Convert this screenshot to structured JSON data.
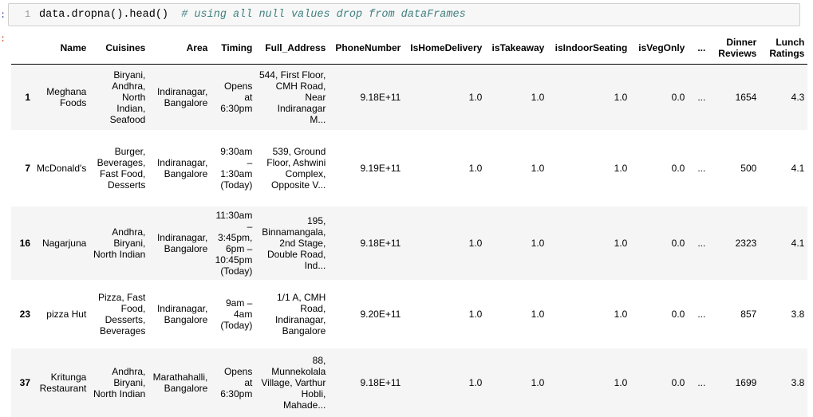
{
  "prompt": {
    "in_marker": ":",
    "out_marker": ":"
  },
  "code_cell": {
    "line_number": "1",
    "code": "data.dropna().head()",
    "comment": "# using all null values drop from dataFrames"
  },
  "table": {
    "columns": [
      "",
      "Name",
      "Cuisines",
      "Area",
      "Timing",
      "Full_Address",
      "PhoneNumber",
      "IsHomeDelivery",
      "isTakeaway",
      "isIndoorSeating",
      "isVegOnly",
      "...",
      "Dinner Reviews",
      "Lunch Ratings"
    ],
    "rows": [
      [
        "1",
        "Meghana Foods",
        "Biryani, Andhra, North Indian, Seafood",
        "Indiranagar, Bangalore",
        "Opens at 6:30pm",
        "544, First Floor, CMH Road, Near Indiranagar M...",
        "9.18E+11",
        "1.0",
        "1.0",
        "1.0",
        "0.0",
        "...",
        "1654",
        "4.3"
      ],
      [
        "7",
        "McDonald's",
        "Burger, Beverages, Fast Food, Desserts",
        "Indiranagar, Bangalore",
        "9:30am – 1:30am (Today)",
        "539, Ground Floor, Ashwini Complex, Opposite V...",
        "9.19E+11",
        "1.0",
        "1.0",
        "1.0",
        "0.0",
        "...",
        "500",
        "4.1"
      ],
      [
        "16",
        "Nagarjuna",
        "Andhra, Biryani, North Indian",
        "Indiranagar, Bangalore",
        "11:30am – 3:45pm, 6pm – 10:45pm (Today)",
        "195, Binnamangala, 2nd Stage, Double Road, Ind...",
        "9.18E+11",
        "1.0",
        "1.0",
        "1.0",
        "0.0",
        "...",
        "2323",
        "4.1"
      ],
      [
        "23",
        "pizza Hut",
        "Pizza, Fast Food, Desserts, Beverages",
        "Indiranagar, Bangalore",
        "9am – 4am (Today)",
        "1/1 A, CMH Road, Indiranagar, Bangalore",
        "9.20E+11",
        "1.0",
        "1.0",
        "1.0",
        "0.0",
        "...",
        "857",
        "3.8"
      ],
      [
        "37",
        "Kritunga Restaurant",
        "Andhra, Biryani, North Indian",
        "Marathahalli, Bangalore",
        "Opens at 6:30pm",
        "88, Munnekolala Village, Varthur Hobli, Mahade...",
        "9.18E+11",
        "1.0",
        "1.0",
        "1.0",
        "0.0",
        "...",
        "1699",
        "3.8"
      ]
    ]
  }
}
